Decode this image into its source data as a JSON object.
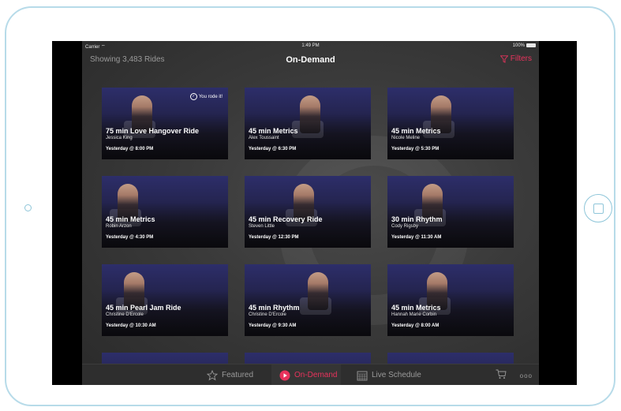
{
  "status": {
    "carrier": "Carrier",
    "time": "1:49 PM",
    "battery": "100%"
  },
  "nav": {
    "count_text": "Showing 3,483 Rides",
    "title": "On-Demand",
    "filters_label": "Filters"
  },
  "accent_color": "#e8335c",
  "rides": [
    {
      "name": "75 min Love Hangover Ride",
      "instructor": "Jessica King",
      "when": "Yesterday @ 8:00 PM",
      "ridden_label": "You rode it!"
    },
    {
      "name": "45 min Metrics",
      "instructor": "Alex Toussaint",
      "when": "Yesterday @ 6:30 PM"
    },
    {
      "name": "45 min Metrics",
      "instructor": "Nicole Meline",
      "when": "Yesterday @ 5:30 PM"
    },
    {
      "name": "45 min Metrics",
      "instructor": "Robin Arzon",
      "when": "Yesterday @ 4:30 PM"
    },
    {
      "name": "45 min Recovery Ride",
      "instructor": "Steven Little",
      "when": "Yesterday @ 12:30 PM"
    },
    {
      "name": "30 min Rhythm",
      "instructor": "Cody Rigsby",
      "when": "Yesterday @ 11:30 AM"
    },
    {
      "name": "45 min Pearl Jam Ride",
      "instructor": "Christine D'Ercole",
      "when": "Yesterday @ 10:30 AM"
    },
    {
      "name": "45 min Rhythm",
      "instructor": "Christine D'Ercole",
      "when": "Yesterday @ 9:30 AM"
    },
    {
      "name": "45 min Metrics",
      "instructor": "Hannah Marie Corbin",
      "when": "Yesterday @ 8:00 AM"
    }
  ],
  "tabs": [
    {
      "label": "Featured",
      "icon": "star-icon",
      "active": false
    },
    {
      "label": "On-Demand",
      "icon": "play-icon",
      "active": true
    },
    {
      "label": "Live Schedule",
      "icon": "calendar-icon",
      "active": false
    }
  ],
  "tabbar_icons": {
    "cart": "cart-icon",
    "more": "more-icon"
  },
  "more_label": "ooo"
}
